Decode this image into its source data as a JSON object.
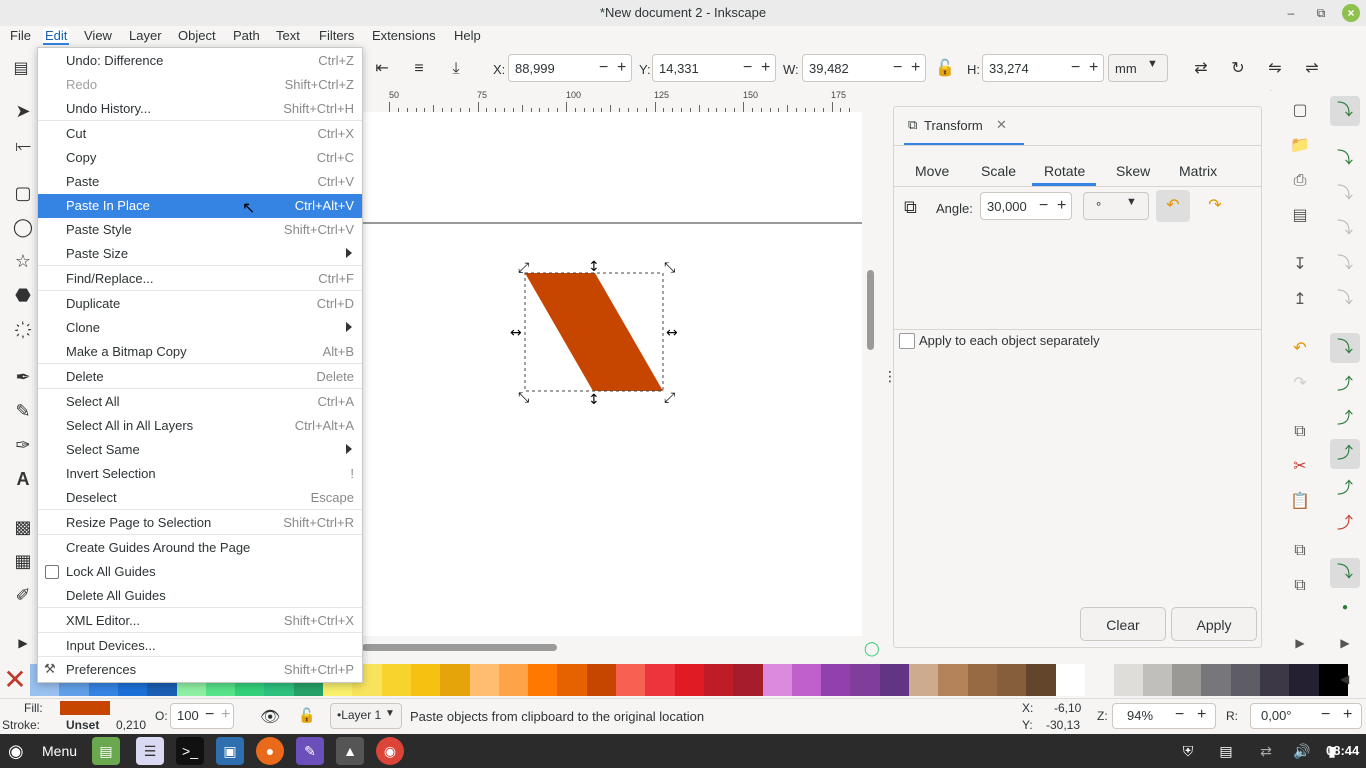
{
  "window": {
    "title": "*New document 2 - Inkscape"
  },
  "menubar": [
    "File",
    "Edit",
    "View",
    "Layer",
    "Object",
    "Path",
    "Text",
    "Filters",
    "Extensions",
    "Help"
  ],
  "toolctl": {
    "x_label": "X:",
    "x_value": "88,999",
    "y_label": "Y:",
    "y_value": "14,331",
    "w_label": "W:",
    "w_value": "39,482",
    "h_label": "H:",
    "h_value": "33,274",
    "unit": "mm"
  },
  "ruler": [
    "50",
    "75",
    "100",
    "125",
    "150",
    "175"
  ],
  "transform": {
    "title": "Transform",
    "tabs": [
      "Move",
      "Scale",
      "Rotate",
      "Skew",
      "Matrix"
    ],
    "angle_label": "Angle:",
    "angle_value": "30,000",
    "angle_unit": "°",
    "apply_each": "Apply to each object separately",
    "clear": "Clear",
    "apply": "Apply"
  },
  "editmenu": [
    {
      "label": "Undo: Difference",
      "shortcut": "Ctrl+Z"
    },
    {
      "label": "Redo",
      "shortcut": "Shift+Ctrl+Z",
      "disabled": true
    },
    {
      "label": "Undo History...",
      "shortcut": "Shift+Ctrl+H"
    },
    {
      "label": "Cut",
      "shortcut": "Ctrl+X"
    },
    {
      "label": "Copy",
      "shortcut": "Ctrl+C"
    },
    {
      "label": "Paste",
      "shortcut": "Ctrl+V"
    },
    {
      "label": "Paste In Place",
      "shortcut": "Ctrl+Alt+V",
      "selected": true
    },
    {
      "label": "Paste Style",
      "shortcut": "Shift+Ctrl+V"
    },
    {
      "label": "Paste Size",
      "shortcut": ""
    },
    {
      "label": "Find/Replace...",
      "shortcut": "Ctrl+F"
    },
    {
      "label": "Duplicate",
      "shortcut": "Ctrl+D"
    },
    {
      "label": "Clone",
      "shortcut": ""
    },
    {
      "label": "Make a Bitmap Copy",
      "shortcut": "Alt+B"
    },
    {
      "label": "Delete",
      "shortcut": "Delete"
    },
    {
      "label": "Select All",
      "shortcut": "Ctrl+A"
    },
    {
      "label": "Select All in All Layers",
      "shortcut": "Ctrl+Alt+A"
    },
    {
      "label": "Select Same",
      "shortcut": ""
    },
    {
      "label": "Invert Selection",
      "shortcut": "!"
    },
    {
      "label": "Deselect",
      "shortcut": "Escape"
    },
    {
      "label": "Resize Page to Selection",
      "shortcut": "Shift+Ctrl+R"
    },
    {
      "label": "Create Guides Around the Page",
      "shortcut": ""
    },
    {
      "label": "Lock All Guides",
      "shortcut": ""
    },
    {
      "label": "Delete All Guides",
      "shortcut": ""
    },
    {
      "label": "XML Editor...",
      "shortcut": "Shift+Ctrl+X"
    },
    {
      "label": "Input Devices...",
      "shortcut": ""
    },
    {
      "label": "Preferences",
      "shortcut": "Shift+Ctrl+P"
    }
  ],
  "status": {
    "fill_label": "Fill:",
    "stroke_label": "Stroke:",
    "stroke_value": "Unset",
    "stroke_width": "0,210",
    "opacity_label": "O:",
    "opacity_value": "100",
    "layer": "•Layer 1",
    "message": "Paste objects from clipboard to the original location",
    "x_label": "X:",
    "x_value": "-6,10",
    "y_label": "Y:",
    "y_value": "-30,13",
    "zoom_label": "Z:",
    "zoom_value": "94%",
    "rotation_label": "R:",
    "rotation_value": "0,00°"
  },
  "taskbar": {
    "menu_label": "Menu",
    "clock": "08:44"
  },
  "colors": {
    "shape": "#c64600",
    "accent": "#3584e4"
  }
}
